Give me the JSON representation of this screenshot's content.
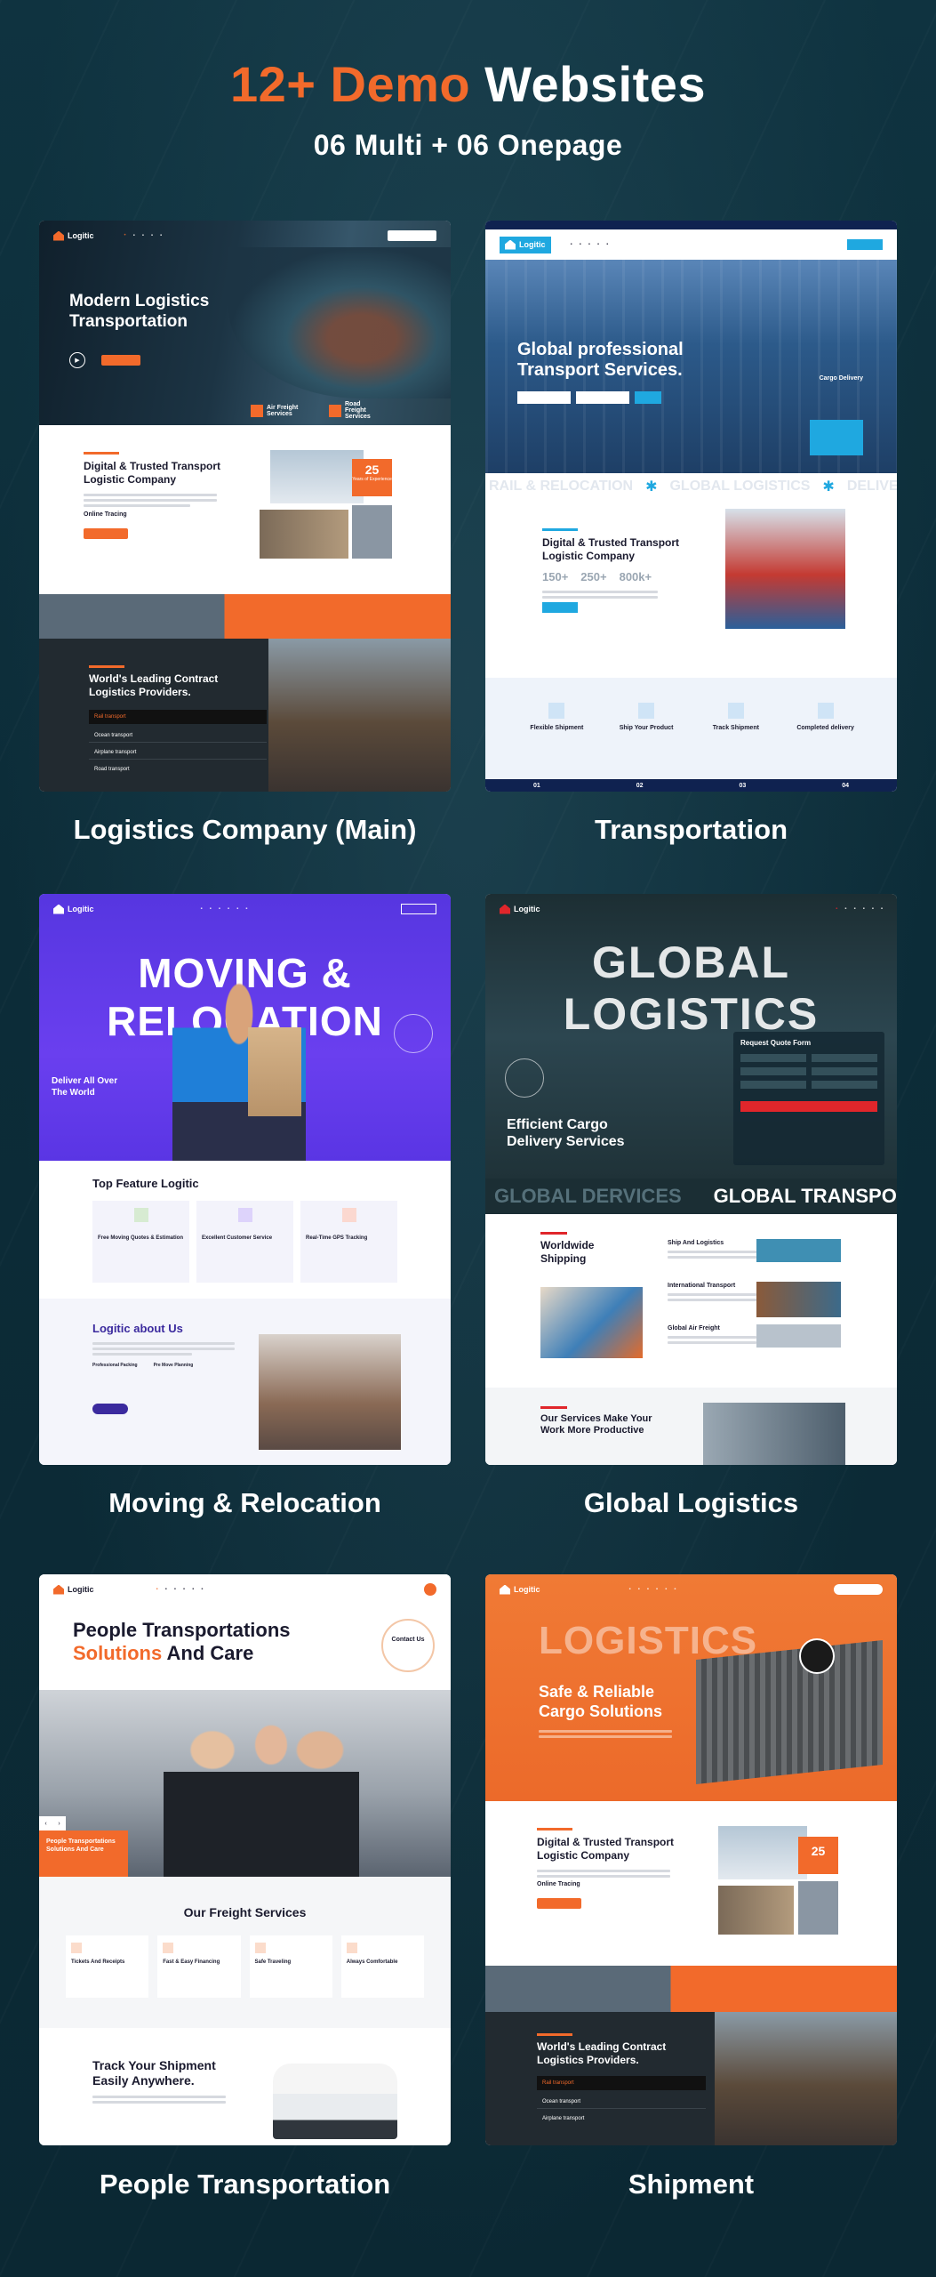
{
  "header": {
    "title_number": "12+ Demo",
    "title_rest": "Websites",
    "subtitle": "06 Multi + 06 Onepage"
  },
  "colors": {
    "accent": "#f26a2b",
    "background": "#0d2f3b"
  },
  "demos": [
    {
      "caption": "Logistics Company (Main)",
      "logo": "Logitic",
      "hero_title": "Modern Logistics Transportation",
      "feature_1": "Air Freight Services",
      "feature_2": "Road Freight Services",
      "section_title": "Digital & Trusted Transport Logistic Company",
      "badge_number": "25",
      "badge_text": "Years of Experience",
      "item_online": "Online Tracing",
      "dark_title": "World's Leading Contract Logistics Providers.",
      "list": [
        "Rail transport",
        "Ocean transport",
        "Airplane transport",
        "Road transport"
      ]
    },
    {
      "caption": "Transportation",
      "logo": "Logitic",
      "hero_title": "Global professional Transport Services.",
      "card_label": "Cargo Delivery",
      "marquee": [
        "RAIL & RELOCATION",
        "GLOBAL LOGISTICS",
        "DELIVERY NE"
      ],
      "section_title": "Digital & Trusted Transport Logistic Company",
      "stats": [
        "150+",
        "250+",
        "800k+"
      ],
      "features": [
        "Flexible Shipment",
        "Ship Your Product",
        "Track Shipment",
        "Completed delivery"
      ],
      "steps": [
        "01",
        "02",
        "03",
        "04"
      ]
    },
    {
      "caption": "Moving & Relocation",
      "logo": "Logitic",
      "hero_big": "MOVING & RELOCATION",
      "hero_sub": "Deliver All Over The World",
      "feature_title": "Top Feature Logitic",
      "features": [
        "Free Moving Quotes & Estimation",
        "Excellent Customer Service",
        "Real-Time GPS Tracking"
      ],
      "about_title": "Logitic about Us",
      "about_items": [
        "Professional Packing",
        "Pre Move Planning"
      ]
    },
    {
      "caption": "Global Logistics",
      "logo": "Logitic",
      "hero_big": "GLOBAL LOGISTICS",
      "hero_sub": "Efficient Cargo Delivery Services",
      "form_title": "Request Quote Form",
      "strip": [
        "GLOBAL DERVICES",
        "GLOBAL TRANSPO"
      ],
      "section_title": "Worldwide Shipping",
      "services": [
        "Ship And Logistics",
        "International Transport",
        "Global Air Freight"
      ],
      "bottom_title": "Our Services Make Your Work More Productive"
    },
    {
      "caption": "People Transportation",
      "logo": "Logitic",
      "hero_line1": "People Transportations",
      "hero_accent": "Solutions",
      "hero_rest": "And Care",
      "contact": "Contact Us",
      "photo_tag": "People Transportations Solutions And Care",
      "services_title": "Our Freight Services",
      "services": [
        "Tickets And Receipts",
        "Fast & Easy Financing",
        "Safe Traveling",
        "Always Comfortable"
      ],
      "track_title": "Track Your Shipment Easily Anywhere."
    },
    {
      "caption": "Shipment",
      "logo": "Logitic",
      "hero_big": "LOGISTICS",
      "hero_title": "Safe & Reliable Cargo Solutions",
      "section_title": "Digital & Trusted Transport Logistic Company",
      "badge_number": "25",
      "item_online": "Online Tracing",
      "dark_title": "World's Leading Contract Logistics Providers.",
      "list": [
        "Rail transport",
        "Ocean transport",
        "Airplane transport"
      ]
    }
  ]
}
